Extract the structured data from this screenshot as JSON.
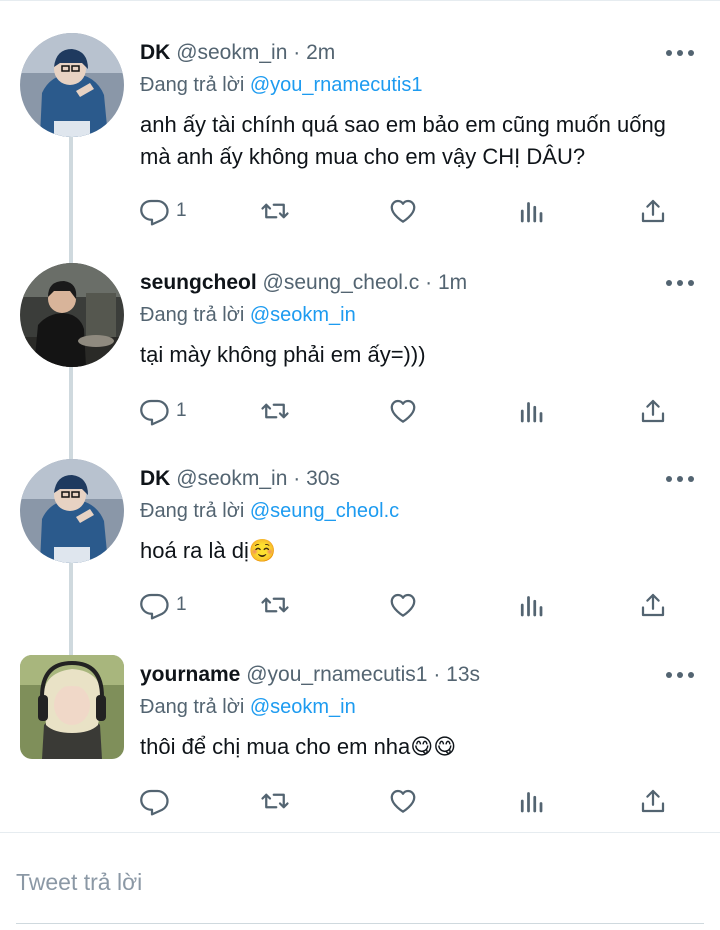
{
  "tweets": [
    {
      "name": "DK",
      "handle": "@seokm_in",
      "separator": "·",
      "time": "2m",
      "reply_prefix": "Đang trả lời",
      "reply_to": "@you_rnamecutis1",
      "text": "anh ấy tài chính quá sao em bảo em cũng muốn uống mà anh ấy không mua cho em vậy CHỊ DÂU?",
      "reply_count": "1",
      "avatar": "dk-avatar"
    },
    {
      "name": "seungcheol",
      "handle": "@seung_cheol.c",
      "separator": "·",
      "time": "1m",
      "reply_prefix": "Đang trả lời",
      "reply_to": "@seokm_in",
      "text": "tại mày không phải em ấy=)))",
      "reply_count": "1",
      "avatar": "seungcheol-avatar"
    },
    {
      "name": "DK",
      "handle": "@seokm_in",
      "separator": "·",
      "time": "30s",
      "reply_prefix": "Đang trả lời",
      "reply_to": "@seung_cheol.c",
      "text": "hoá ra là dị☺️",
      "reply_count": "1",
      "avatar": "dk-avatar"
    },
    {
      "name": "yourname",
      "handle": "@you_rnamecutis1",
      "separator": "·",
      "time": "13s",
      "reply_prefix": "Đang trả lời",
      "reply_to": "@seokm_in",
      "text": "thôi để chị mua cho em nha😋😋",
      "reply_count": "",
      "avatar": "yourname-avatar"
    }
  ],
  "reply_box": {
    "placeholder": "Tweet trả lời"
  },
  "icons": {
    "reply": "reply-icon",
    "retweet": "retweet-icon",
    "like": "heart-icon",
    "views": "views-icon",
    "share": "share-icon",
    "more": "more-icon"
  },
  "colors": {
    "accent": "#1d9bf0",
    "secondary_text": "#536471",
    "icon": "#536471",
    "thread_line": "#cfd9de"
  }
}
